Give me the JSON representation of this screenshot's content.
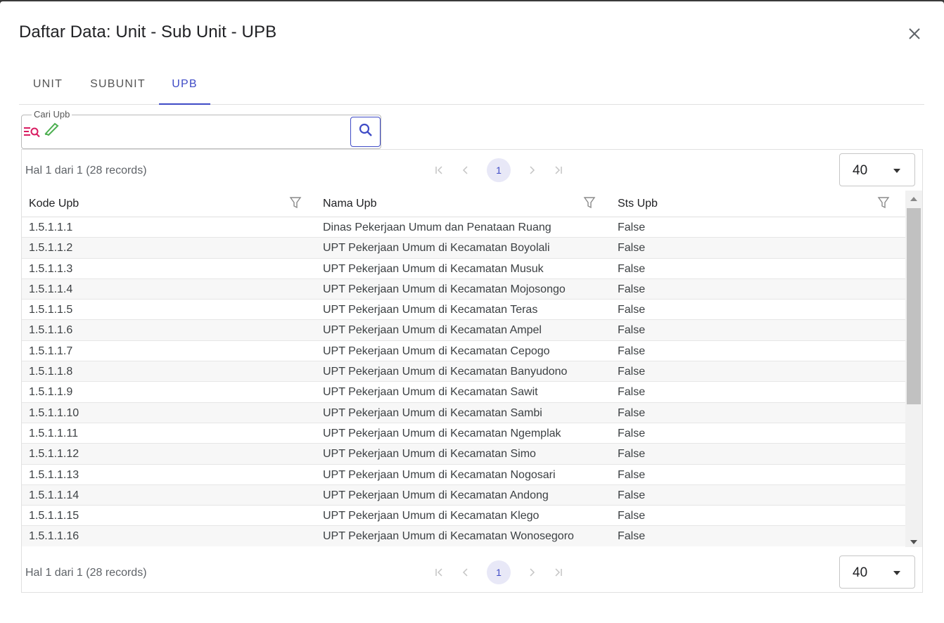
{
  "dialog": {
    "title": "Daftar Data: Unit - Sub Unit - UPB",
    "close_icon": "close-icon"
  },
  "tabs": [
    {
      "label": "UNIT",
      "active": false
    },
    {
      "label": "SUBUNIT",
      "active": false
    },
    {
      "label": "UPB",
      "active": true
    }
  ],
  "search": {
    "legend": "Cari Upb",
    "value": "",
    "icons": [
      "filter-search-icon",
      "pencil-icon",
      "search-icon"
    ]
  },
  "pager": {
    "info": "Hal 1 dari 1 (28 records)",
    "current_page": "1",
    "page_size": "40"
  },
  "columns": [
    "Kode Upb",
    "Nama Upb",
    "Sts Upb"
  ],
  "rows": [
    [
      "1.5.1.1.1",
      "Dinas Pekerjaan Umum dan Penataan Ruang",
      "False"
    ],
    [
      "1.5.1.1.2",
      "UPT Pekerjaan Umum di Kecamatan Boyolali",
      "False"
    ],
    [
      "1.5.1.1.3",
      "UPT Pekerjaan Umum di Kecamatan Musuk",
      "False"
    ],
    [
      "1.5.1.1.4",
      "UPT Pekerjaan Umum di Kecamatan Mojosongo",
      "False"
    ],
    [
      "1.5.1.1.5",
      "UPT Pekerjaan Umum di Kecamatan Teras",
      "False"
    ],
    [
      "1.5.1.1.6",
      "UPT Pekerjaan Umum di Kecamatan Ampel",
      "False"
    ],
    [
      "1.5.1.1.7",
      "UPT Pekerjaan Umum di Kecamatan Cepogo",
      "False"
    ],
    [
      "1.5.1.1.8",
      "UPT Pekerjaan Umum di Kecamatan Banyudono",
      "False"
    ],
    [
      "1.5.1.1.9",
      "UPT Pekerjaan Umum di Kecamatan Sawit",
      "False"
    ],
    [
      "1.5.1.1.10",
      "UPT Pekerjaan Umum di Kecamatan Sambi",
      "False"
    ],
    [
      "1.5.1.1.11",
      "UPT Pekerjaan Umum di Kecamatan Ngemplak",
      "False"
    ],
    [
      "1.5.1.1.12",
      "UPT Pekerjaan Umum di Kecamatan Simo",
      "False"
    ],
    [
      "1.5.1.1.13",
      "UPT Pekerjaan Umum di Kecamatan Nogosari",
      "False"
    ],
    [
      "1.5.1.1.14",
      "UPT Pekerjaan Umum di Kecamatan Andong",
      "False"
    ],
    [
      "1.5.1.1.15",
      "UPT Pekerjaan Umum di Kecamatan Klego",
      "False"
    ],
    [
      "1.5.1.1.16",
      "UPT Pekerjaan Umum di Kecamatan Wonosegoro",
      "False"
    ]
  ],
  "colors": {
    "accent": "#3f4bc6",
    "filter_icon": "#d81b60",
    "pencil_icon": "#4caf50"
  }
}
